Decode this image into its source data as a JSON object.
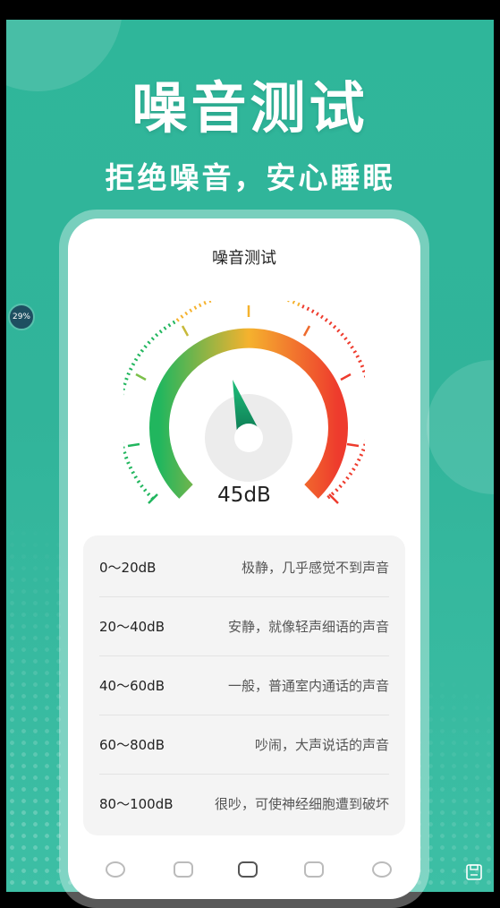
{
  "hero": {
    "title": "噪音测试",
    "subtitle": "拒绝噪音，安心睡眠"
  },
  "card": {
    "title": "噪音测试",
    "db_reading": "45dB",
    "gauge_needle_value_db": 45,
    "gauge_colors": [
      "#21b65e",
      "#f5b22e",
      "#ee3b2d"
    ]
  },
  "levels": [
    {
      "range": "0～20dB",
      "desc": "极静，几乎感觉不到声音"
    },
    {
      "range": "20～40dB",
      "desc": "安静，就像轻声细语的声音"
    },
    {
      "range": "40～60dB",
      "desc": "一般，普通室内通话的声音"
    },
    {
      "range": "60～80dB",
      "desc": "吵闹，大声说话的声音"
    },
    {
      "range": "80～100dB",
      "desc": "很吵，可使神经细胞遭到破坏"
    }
  ],
  "floating_badge": {
    "text": "29%"
  },
  "colors": {
    "brand": "#2fb69a",
    "accent": "#1fbf7a"
  }
}
